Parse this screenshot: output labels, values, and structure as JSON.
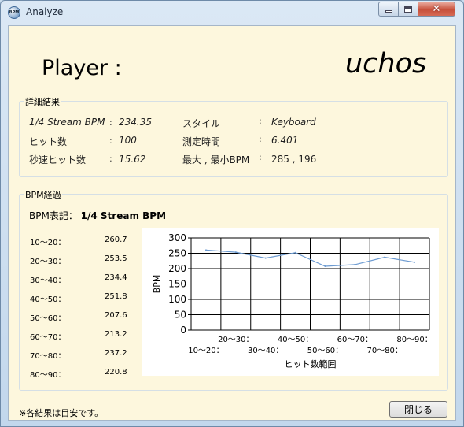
{
  "window": {
    "title": "Analyze",
    "icon_text": "BPM",
    "close_glyph": "✕"
  },
  "player": {
    "label": "Player :",
    "name": "uchos"
  },
  "details": {
    "group_title": "詳細結果",
    "left": [
      {
        "label": "1/4 Stream BPM",
        "value": "234.35"
      },
      {
        "label": "ヒット数",
        "value": "100"
      },
      {
        "label": "秒速ヒット数",
        "value": "15.62"
      }
    ],
    "right": [
      {
        "label": "スタイル",
        "value": "Keyboard"
      },
      {
        "label": "測定時間",
        "value": "6.401"
      },
      {
        "label": "最大 , 最小BPM",
        "value": "285 , 196"
      }
    ],
    "colon": ":"
  },
  "progress": {
    "group_title": "BPM経過",
    "notation_label": "BPM表記：",
    "notation_value": "1/4 Stream BPM",
    "rows": [
      {
        "range": "10～20：",
        "value": "260.7"
      },
      {
        "range": "20～30：",
        "value": "253.5"
      },
      {
        "range": "30～40：",
        "value": "234.4"
      },
      {
        "range": "40～50：",
        "value": "251.8"
      },
      {
        "range": "50～60：",
        "value": "207.6"
      },
      {
        "range": "60～70：",
        "value": "213.2"
      },
      {
        "range": "70～80：",
        "value": "237.2"
      },
      {
        "range": "80～90：",
        "value": "220.8"
      }
    ]
  },
  "chart_data": {
    "type": "line",
    "categories": [
      "10～20：",
      "20～30：",
      "30～40：",
      "40～50：",
      "50～60：",
      "60～70：",
      "70～80：",
      "80～90："
    ],
    "series": [
      {
        "values": [
          260.7,
          253.5,
          234.4,
          251.8,
          207.6,
          213.2,
          237.2,
          220.8
        ]
      }
    ],
    "xlabel": "ヒット数範囲",
    "ylabel": "BPM",
    "ylim": [
      0,
      300
    ],
    "yticks": [
      0,
      50,
      100,
      150,
      200,
      250,
      300
    ],
    "grid": true,
    "line_color": "#6d9bd1"
  },
  "footer": {
    "note": "※各結果は目安です。",
    "close_label": "閉じる"
  }
}
